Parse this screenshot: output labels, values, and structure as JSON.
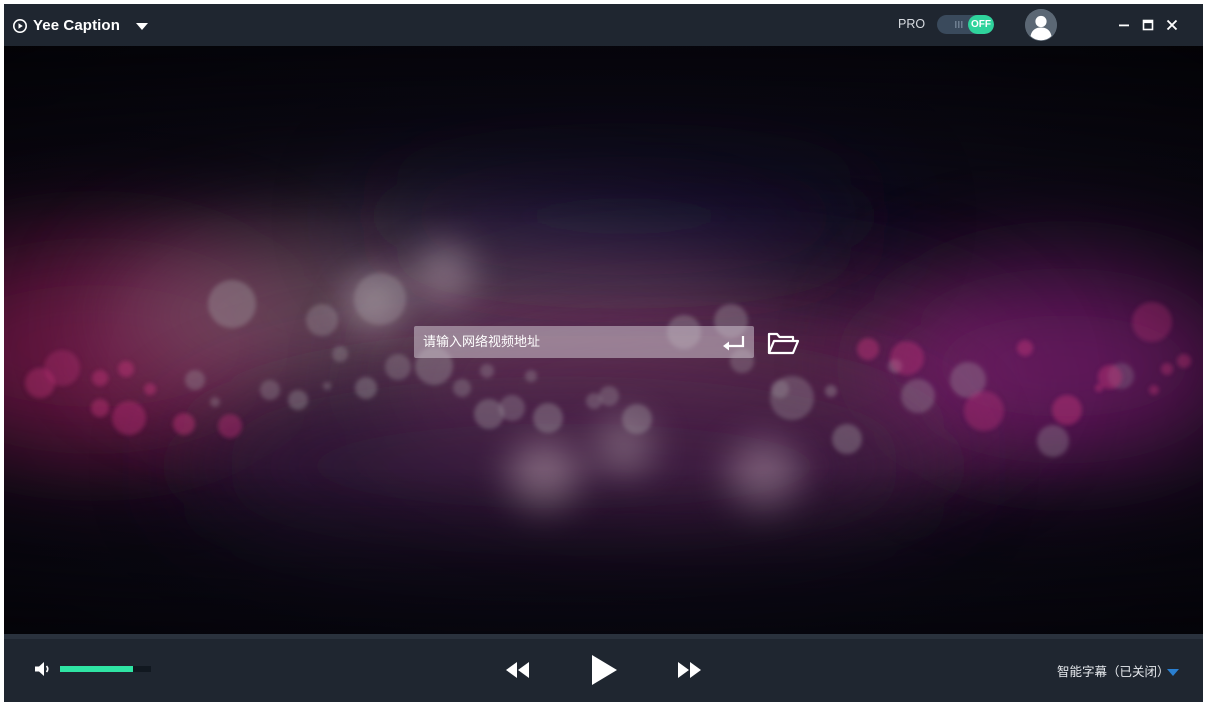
{
  "app": {
    "title": "Yee Caption"
  },
  "header": {
    "pro_label": "PRO",
    "pro_toggle_state": "OFF"
  },
  "main": {
    "url_input": {
      "placeholder": "请输入网络视频地址",
      "value": ""
    }
  },
  "controls": {
    "volume_level": 0.8,
    "subtitle_label": "智能字幕（已关闭）"
  },
  "colors": {
    "accent": "#2fe4a4",
    "titlebar_bg": "#1f2630",
    "toggle_track": "#3a4a5c",
    "toggle_knob": "#2fd39c",
    "dropdown_arrow": "#2a7fd0"
  },
  "icons": {
    "app": "clock-play-icon",
    "menu": "chevron-down-icon",
    "avatar": "user-icon",
    "minimize": "minimize-icon",
    "maximize": "maximize-icon",
    "close": "close-icon",
    "enter": "enter-return-icon",
    "folder": "folder-open-icon",
    "volume": "volume-icon",
    "rewind": "rewind-icon",
    "play": "play-icon",
    "forward": "fast-forward-icon",
    "subtitle_dropdown": "triangle-down-icon"
  }
}
